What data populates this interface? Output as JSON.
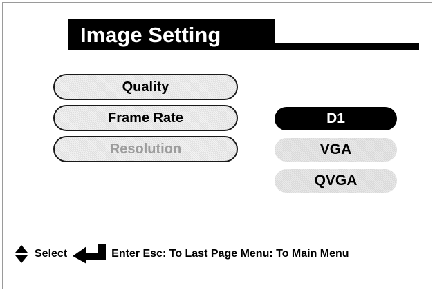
{
  "title": "Image Setting",
  "menu": {
    "items": [
      {
        "label": "Quality",
        "state": "normal"
      },
      {
        "label": "Frame Rate",
        "state": "normal"
      },
      {
        "label": "Resolution",
        "state": "disabled"
      }
    ]
  },
  "options": {
    "items": [
      {
        "label": "D1",
        "selected": true
      },
      {
        "label": "VGA",
        "selected": false
      },
      {
        "label": "QVGA",
        "selected": false
      }
    ]
  },
  "footer": {
    "updown_icon": "up-down-arrow-icon",
    "select_label": "Select",
    "enter_icon": "enter-return-arrow-icon",
    "hints": "Enter Esc: To Last Page Menu: To Main Menu"
  },
  "colors": {
    "selected_bg": "#000000",
    "disabled_text": "#9c9c9c"
  }
}
